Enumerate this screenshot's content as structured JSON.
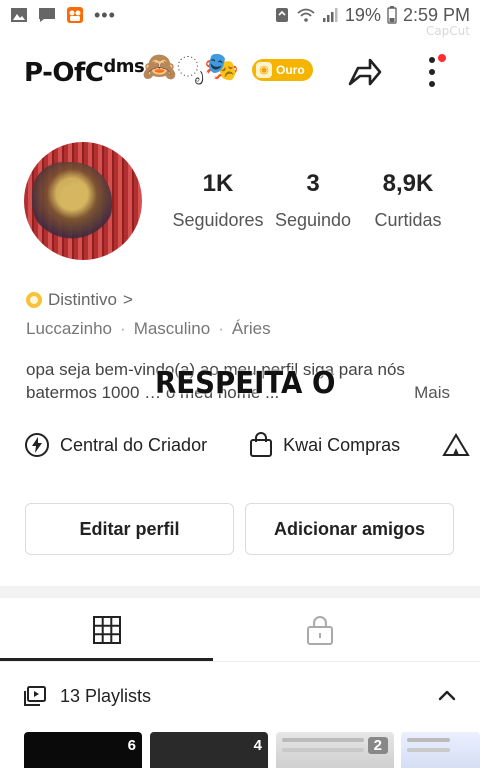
{
  "status_bar": {
    "battery_percent": "19%",
    "time": "2:59 PM",
    "watermark": "CapCut"
  },
  "header": {
    "username_main": "P-OfC",
    "username_sup": "dms",
    "emoji_text": "🙈ೃ🎭",
    "badge_label": "Ouro",
    "accent_color": "#f5b400",
    "notification_dot_color": "#ff2d2d"
  },
  "profile": {
    "followers_count": "1K",
    "followers_label": "Seguidores",
    "following_count": "3",
    "following_label": "Seguindo",
    "likes_count": "8,9K",
    "likes_label": "Curtidas"
  },
  "badge_row": {
    "label": "Distintivo",
    "chevron": ">"
  },
  "meta": {
    "name": "Luccazinho",
    "gender": "Masculino",
    "sign": "Áries",
    "separator": "·"
  },
  "bio": {
    "line1": "opa seja bem-vindo(a) ao meu perfil siga para nós",
    "line2": "batermos 1000 … o meu nome ...",
    "more": "Mais",
    "overlay_text": "RESPEITA O"
  },
  "tools": [
    {
      "label": "Central do Criador",
      "icon": "lightning-icon"
    },
    {
      "label": "Kwai Compras",
      "icon": "shopping-bag-icon"
    },
    {
      "label": "",
      "icon": "tent-icon"
    }
  ],
  "buttons": {
    "edit_profile": "Editar perfil",
    "add_friends": "Adicionar amigos"
  },
  "tabs": [
    {
      "name": "grid",
      "icon": "grid-icon",
      "active": true
    },
    {
      "name": "private",
      "icon": "lock-icon",
      "active": false
    }
  ],
  "playlists": {
    "title": "13 Playlists",
    "thumbs": [
      {
        "count": "6"
      },
      {
        "count": "4"
      },
      {
        "count": "2"
      },
      {
        "count": ""
      }
    ]
  }
}
